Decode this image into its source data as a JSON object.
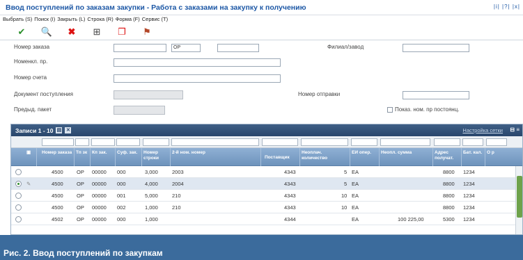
{
  "window": {
    "title": "Ввод поступлений по заказам закупки - Работа с заказами на закупку к получению",
    "controls": "|i| |?| |x|"
  },
  "menu": [
    "Выбрать (S)",
    "Поиск (I)",
    "Закрыть (L)",
    "Строка (R)",
    "Форма (F)",
    "Сервис (T)"
  ],
  "toolbar": {
    "icons": [
      "check-icon",
      "search-icon",
      "delete-icon",
      "grid-icon",
      "document-icon",
      "user-icon"
    ],
    "glyphs": [
      "✔",
      "🔍",
      "✖",
      "⊞",
      "❐",
      "⚑"
    ]
  },
  "form": {
    "order_number_label": "Номер заказа",
    "order_number_value": "",
    "order_type_value": "OP",
    "order_company_value": "",
    "branch_label": "Филиал/завод",
    "item_number_label": "Номенкл. пр.",
    "account_number_label": "Номер счета",
    "receipt_document_label": "Документ поступления",
    "shipment_number_label": "Номер отправки",
    "prev_batch_label": "Предыд. пакет",
    "show_nonstock_label": "Показ. ном. пр постоянц."
  },
  "grid": {
    "header_title": "Записи 1 - 10",
    "customize_label": "Настройка сетки",
    "columns": [
      "Номер заказа",
      "Тп зк",
      "Кп зак.",
      "Суф. зак.",
      "Номер строки",
      "2-й ном. номер",
      "Поставщик",
      "Неоплач. количество",
      "ЕИ опер.",
      "Неопл. сумма",
      "Адрес получат.",
      "Бат. кал.",
      "О р"
    ],
    "rows": [
      {
        "order": "4500",
        "type": "OP",
        "company": "00000",
        "suffix": "000",
        "line": "3,000",
        "item2": "2003",
        "supplier": "4343",
        "qty": "5",
        "uom": "EA",
        "amount": "",
        "address": "8800",
        "batch": "1234",
        "selected": false
      },
      {
        "order": "4500",
        "type": "OP",
        "company": "00000",
        "suffix": "000",
        "line": "4,000",
        "item2": "2004",
        "supplier": "4343",
        "qty": "5",
        "uom": "EA",
        "amount": "",
        "address": "8800",
        "batch": "1234",
        "selected": true
      },
      {
        "order": "4500",
        "type": "OP",
        "company": "00000",
        "suffix": "001",
        "line": "5,000",
        "item2": "210",
        "supplier": "4343",
        "qty": "10",
        "uom": "EA",
        "amount": "",
        "address": "8800",
        "batch": "1234",
        "selected": false
      },
      {
        "order": "4500",
        "type": "OP",
        "company": "00000",
        "suffix": "002",
        "line": "1,000",
        "item2": "210",
        "supplier": "4343",
        "qty": "10",
        "uom": "EA",
        "amount": "",
        "address": "8800",
        "batch": "1234",
        "selected": false
      },
      {
        "order": "4502",
        "type": "OP",
        "company": "00000",
        "suffix": "000",
        "line": "1,000",
        "item2": "",
        "supplier": "4344",
        "qty": "",
        "uom": "EA",
        "amount": "100 225,00",
        "address": "5300",
        "batch": "1234",
        "selected": false
      }
    ]
  },
  "caption": "Рис. 2. Ввод поступлений по закупкам",
  "colors": {
    "title_blue": "#1c57a5",
    "grid_header": "#29466c",
    "col_header": "#7a9cc4",
    "caption_bg": "#3b6b9c",
    "scroll_thumb": "#6ea24b"
  }
}
